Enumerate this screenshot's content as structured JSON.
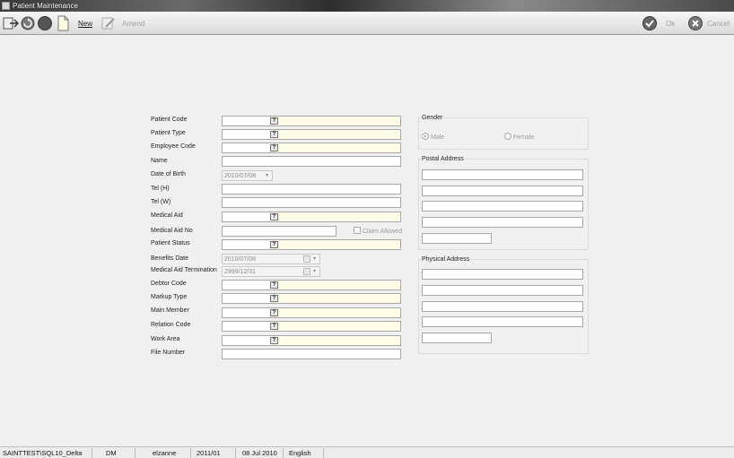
{
  "window": {
    "title": "Patient Maintenance"
  },
  "toolbar": {
    "new_label": "New",
    "amend_label": "Amend",
    "ok_label": "Ok",
    "cancel_label": "Cancel"
  },
  "form": {
    "patient_code_label": "Patient Code",
    "patient_type_label": "Patient Type",
    "employee_code_label": "Employee Code",
    "name_label": "Name",
    "dob_label": "Date of Birth",
    "dob_value": "2010/07/08",
    "tel_h_label": "Tel (H)",
    "tel_w_label": "Tel (W)",
    "medical_aid_label": "Medical Aid",
    "medical_aid_no_label": "Medical Aid No",
    "claim_allowed_label": "Claim Allowed",
    "patient_status_label": "Patient Status",
    "benefits_date_label": "Benefits Date",
    "benefits_date_value": "2010/07/08",
    "termination_label": "Medical Aid Termination",
    "termination_value": "2999/12/31",
    "debtor_code_label": "Debtor Code",
    "markup_type_label": "Markup Type",
    "main_member_label": "Main Member",
    "relation_code_label": "Relation Code",
    "work_area_label": "Work Area",
    "file_number_label": "File Number",
    "lookup_glyph": "?"
  },
  "gender": {
    "title": "Gender",
    "male_label": "Male",
    "female_label": "Female",
    "selected": "Male"
  },
  "postal": {
    "title": "Postal Address"
  },
  "physical": {
    "title": "Physical Address"
  },
  "status": {
    "server": "SAINTTEST\\SQL10_Delta",
    "module": "DM",
    "user": "elzanne",
    "period": "2011/01",
    "date": "08 Jul 2010",
    "language": "English"
  },
  "colors": {
    "lookup_fill": "#fffbe6",
    "disabled_text": "#a0a0a0"
  }
}
